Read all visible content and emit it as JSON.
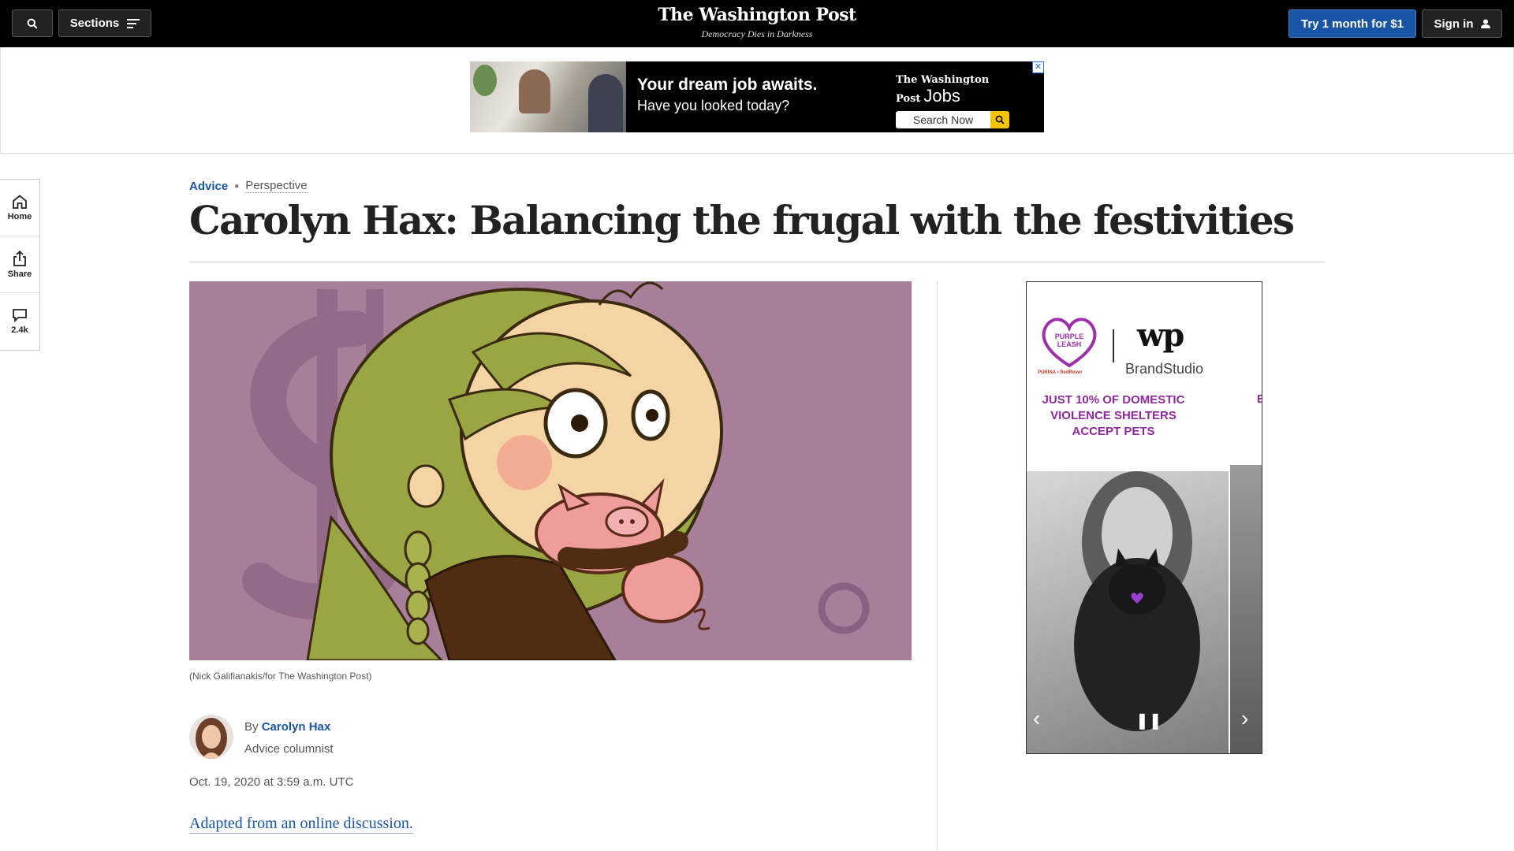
{
  "nav": {
    "sections_label": "Sections",
    "brand_name": "The Washington Post",
    "brand_tagline": "Democracy Dies in Darkness",
    "try_label": "Try 1 month for $1",
    "signin_label": "Sign in"
  },
  "top_ad": {
    "headline": "Your dream job awaits.",
    "subline": "Have you looked today?",
    "logo_text": "The Washington Post",
    "logo_suffix": "Jobs",
    "search_label": "Search Now",
    "close_glyph": "✕"
  },
  "rail": {
    "items": [
      {
        "label": "Home",
        "icon": "home-icon"
      },
      {
        "label": "Share",
        "icon": "share-icon"
      },
      {
        "label": "2.4k",
        "icon": "comment-icon"
      }
    ]
  },
  "article": {
    "section": "Advice",
    "label": "Perspective",
    "headline": "Carolyn Hax: Balancing the frugal with the festivities",
    "caption": "(Nick Galifianakis/for The Washington Post)",
    "byline_prefix": "By",
    "author": "Carolyn Hax",
    "author_role": "Advice columnist",
    "date": "Oct. 19, 2020 at 3:59 a.m. UTC",
    "adapted": "Adapted from an online discussion."
  },
  "side_ad": {
    "logo_heart_text": "PURPLE LEASH PROJECT",
    "sponsor_text": "PURINA • RedRover",
    "wp_mark": "wp",
    "brandstudio": "BrandStudio",
    "message_lines": [
      "JUST 10% OF DOMESTIC",
      "VIOLENCE SHELTERS",
      "ACCEPT PETS"
    ],
    "peek_letter": "E",
    "prev_glyph": "‹",
    "pause_glyph": "❚❚",
    "next_glyph": "›"
  },
  "colors": {
    "brand_blue": "#1955a5",
    "illustration_bg": "#a77f99",
    "ad_purple": "#8e2a9c",
    "nav_bg": "#000000"
  }
}
